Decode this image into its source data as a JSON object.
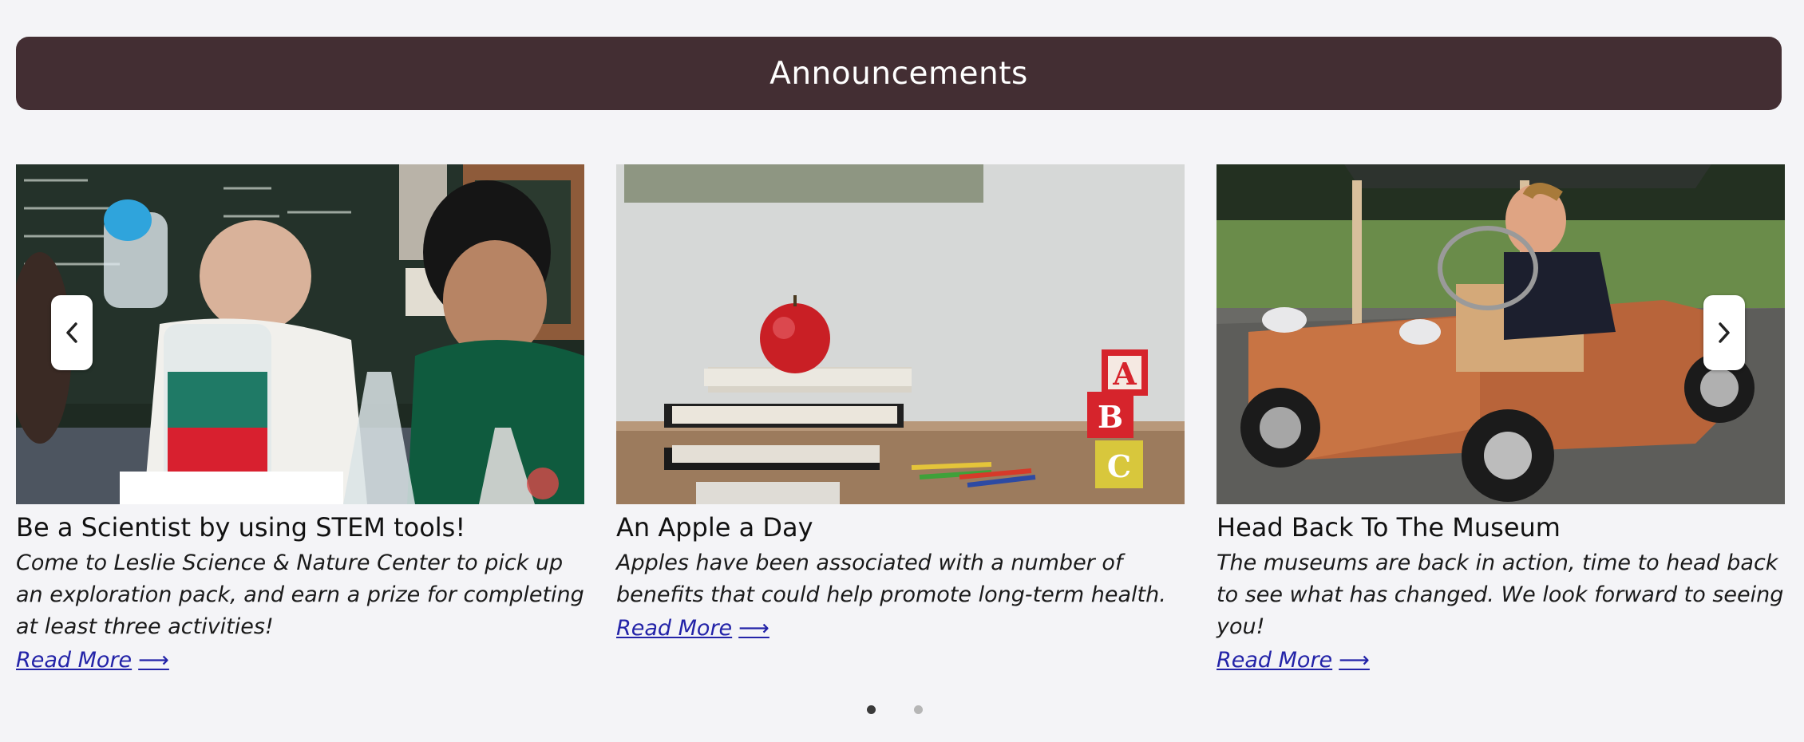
{
  "header": {
    "title": "Announcements",
    "background_color": "#432e33"
  },
  "cards": [
    {
      "title": "Be a Scientist by using STEM tools!",
      "description": "Come to Leslie Science & Nature Center to pick up an exploration pack, and earn a prize for completing at least three activities!",
      "link_label": "Read More",
      "link_arrow": "⟶",
      "image": "scientists-lab-photo"
    },
    {
      "title": "An Apple a Day",
      "description": "Apples have been associated with a number of benefits that could help promote long-term health.",
      "link_label": "Read More",
      "link_arrow": "⟶",
      "image": "apple-books-photo"
    },
    {
      "title": "Head Back To The Museum",
      "description": "The museums are back in action, time to head back to see what has changed. We look forward to seeing you!",
      "link_label": "Read More",
      "link_arrow": "⟶",
      "image": "boy-wooden-car-photo"
    }
  ],
  "carousel": {
    "prev_icon": "chevron-left-icon",
    "next_icon": "chevron-right-icon",
    "pages": 2,
    "active_page": 1
  },
  "colors": {
    "link": "#2323a8",
    "page_background": "#f4f4f7"
  }
}
